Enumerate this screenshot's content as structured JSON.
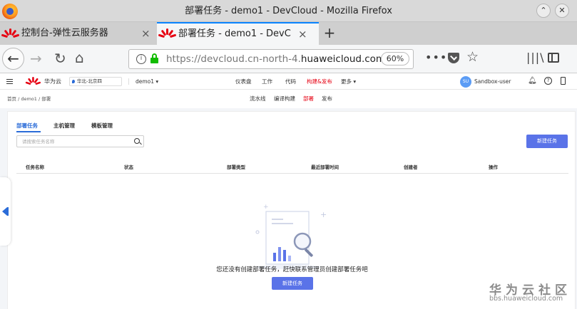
{
  "window": {
    "title": "部署任务 - demo1 - DevCloud - Mozilla Firefox"
  },
  "tabs": [
    {
      "label": "控制台-弹性云服务器",
      "close": "×"
    },
    {
      "label": "部署任务 - demo1 - DevCloud",
      "close": "×"
    }
  ],
  "newtab": "+",
  "navbar": {
    "url_prefix": "https://devcloud.cn-north-4.",
    "url_domain": "huaweicloud.com",
    "zoom": "60%",
    "more": "•••",
    "library": "|||\\"
  },
  "header": {
    "brand": "华为云",
    "region": "华北-北京四",
    "project": "demo1 ▾",
    "nav": [
      "仪表盘",
      "工作",
      "代码",
      "构建&发布",
      "更多 ▾"
    ],
    "active_nav": "构建&发布",
    "user_initials": "SU",
    "username": "Sandbox-user",
    "bell": "♪",
    "help": "?"
  },
  "breadcrumb": "首页  /  demo1  /  部署",
  "subnav": [
    "流水线",
    "编译构建",
    "部署",
    "发布"
  ],
  "active_subnav": "部署",
  "content": {
    "tabs": [
      "部署任务",
      "主机管理",
      "模板管理"
    ],
    "active_tab": "部署任务",
    "search_placeholder": "请搜索任务名称",
    "new_task_button": "新建任务",
    "columns": [
      "任务名称",
      "状态",
      "部署类型",
      "最近部署时间",
      "创建者",
      "操作"
    ],
    "empty_message": "您还没有创建部署任务，赶快联系管理员创建部署任务吧",
    "empty_button": "新建任务"
  },
  "watermark": {
    "title": "华为云社区",
    "subtitle": "bbs.huaweicloud.com"
  },
  "colors": {
    "accent": "#5a73e8",
    "brand_red": "#e60012",
    "link_blue": "#2b6cd8"
  }
}
